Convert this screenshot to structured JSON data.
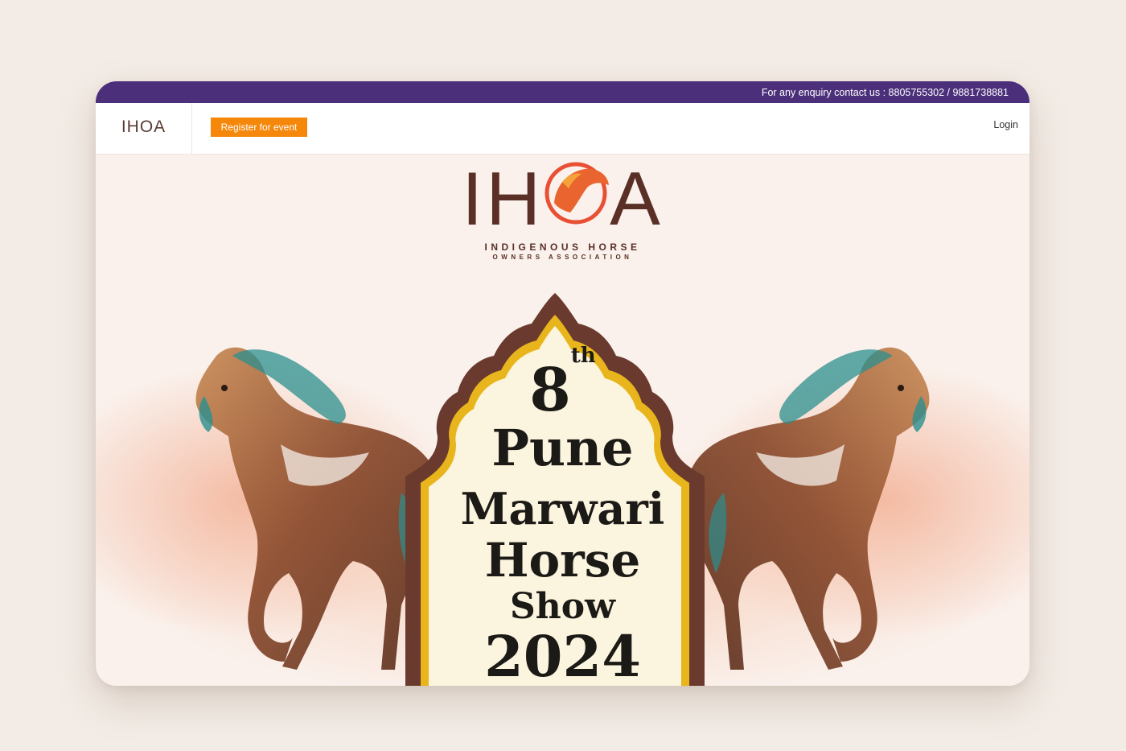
{
  "topbar": {
    "enquiry_text": "For any enquiry contact us : 8805755302 / 9881738881"
  },
  "nav": {
    "logo_text": "IHOA",
    "register_label": "Register for event",
    "login_label": "Login"
  },
  "hero": {
    "logo_letters_left": "IH",
    "logo_letter_right": "A",
    "org_line1": "INDIGENOUS HORSE",
    "org_line2": "OWNERS ASSOCIATION",
    "edition_number": "8",
    "edition_suffix": "th",
    "city": "Pune",
    "breed": "Marwari",
    "word_horse": "Horse",
    "word_show": "Show",
    "year": "2024"
  },
  "colors": {
    "topbar": "#4b2f7a",
    "register_button": "#f5870a",
    "brand_brown": "#5a2f25",
    "arch_outer": "#6b3a2e",
    "arch_gold": "#e8b51c",
    "arch_inner": "#fbf4de",
    "background": "#f3ece6"
  },
  "icons": {
    "logo_mark": "horse-head-icon",
    "decor": "watercolor-horse-illustration"
  }
}
